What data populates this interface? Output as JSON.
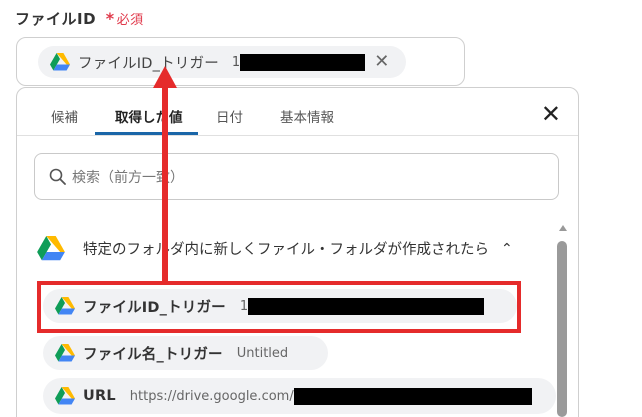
{
  "field": {
    "label": "ファイルID",
    "required_mark": "*",
    "required_label": "必須"
  },
  "selected_chip": {
    "label": "ファイルID_トリガー",
    "value": "1"
  },
  "tabs": [
    {
      "label": "候補"
    },
    {
      "label": "取得した値"
    },
    {
      "label": "日付"
    },
    {
      "label": "基本情報"
    }
  ],
  "search": {
    "placeholder": "検索（前方一致）"
  },
  "group": {
    "title": "特定のフォルダ内に新しくファイル・フォルダが作成されたら"
  },
  "options": [
    {
      "label": "ファイルID_トリガー",
      "value": "1"
    },
    {
      "label": "ファイル名_トリガー",
      "value": "Untitled"
    },
    {
      "label": "URL",
      "value": "https://drive.google.com/"
    }
  ],
  "colors": {
    "accent": "#1a66a8",
    "required": "#e0394b",
    "annotation": "#e52b2b"
  },
  "icons": {
    "drive": "google-drive-icon",
    "close": "close-icon",
    "search": "search-icon",
    "collapse": "chevron-up-icon"
  }
}
